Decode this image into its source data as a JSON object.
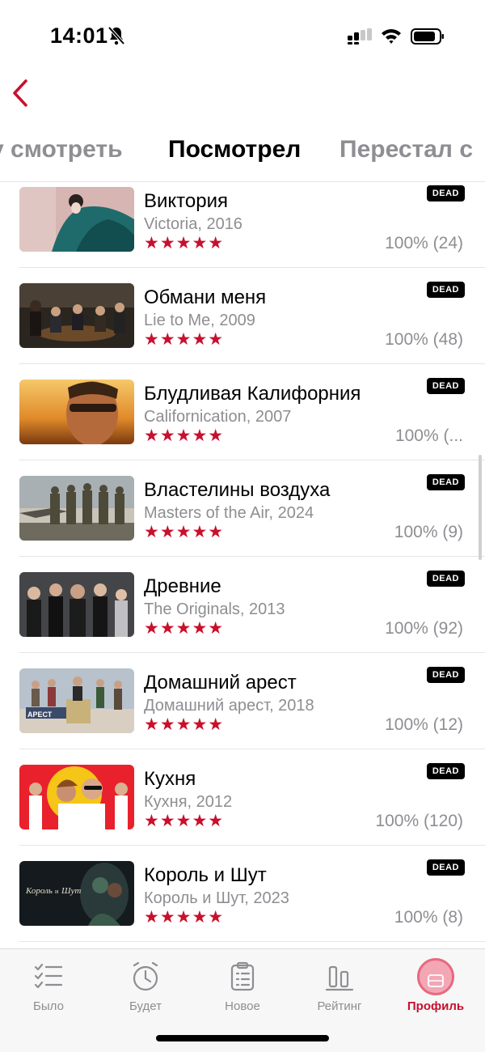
{
  "status_bar": {
    "time": "14:01"
  },
  "tabs": [
    {
      "label": "у смотреть"
    },
    {
      "label": "Посмотрел"
    },
    {
      "label": "Перестал с"
    }
  ],
  "badge_label": "DEAD",
  "shows": [
    {
      "title": "Виктория",
      "subtitle": "Victoria, 2016",
      "stars": "★★★★★",
      "rating": "100% (24)"
    },
    {
      "title": "Обмани меня",
      "subtitle": "Lie to Me, 2009",
      "stars": "★★★★★",
      "rating": "100% (48)"
    },
    {
      "title": "Блудливая Калифорния",
      "subtitle": "Californication, 2007",
      "stars": "★★★★★",
      "rating": "100% (..."
    },
    {
      "title": "Властелины воздуха",
      "subtitle": "Masters of the Air, 2024",
      "stars": "★★★★★",
      "rating": "100% (9)"
    },
    {
      "title": "Древние",
      "subtitle": "The Originals, 2013",
      "stars": "★★★★★",
      "rating": "100% (92)"
    },
    {
      "title": "Домашний арест",
      "subtitle": "Домашний арест, 2018",
      "stars": "★★★★★",
      "rating": "100% (12)"
    },
    {
      "title": "Кухня",
      "subtitle": "Кухня, 2012",
      "stars": "★★★★★",
      "rating": "100% (120)"
    },
    {
      "title": "Король и Шут",
      "subtitle": "Король и Шут, 2023",
      "stars": "★★★★★",
      "rating": "100% (8)"
    }
  ],
  "bottom_nav": [
    {
      "label": "Было",
      "icon": "checklist-icon"
    },
    {
      "label": "Будет",
      "icon": "alarm-clock-icon"
    },
    {
      "label": "Новое",
      "icon": "clipboard-icon"
    },
    {
      "label": "Рейтинг",
      "icon": "bar-chart-icon"
    },
    {
      "label": "Профиль",
      "icon": "profile-icon",
      "active": true
    }
  ],
  "colors": {
    "accent": "#c8102e",
    "muted": "#8e8e93",
    "badge_bg": "#000000"
  }
}
